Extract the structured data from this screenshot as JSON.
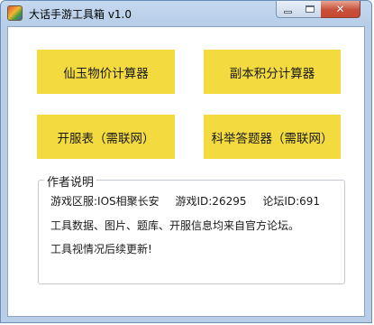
{
  "window": {
    "title": "大话手游工具箱 v1.0",
    "controls": {
      "minimize": "",
      "maximize": "",
      "close": "✕"
    }
  },
  "buttons": {
    "xianyu": "仙玉物价计算器",
    "fuben": "副本积分计算器",
    "kaifu": "开服表（需联网）",
    "keju": "科举答题器（需联网）"
  },
  "author": {
    "group_title": "作者说明",
    "server_label": "游戏区服:IOS相聚长安",
    "game_id": "游戏ID:26295",
    "forum_id": "论坛ID:691",
    "line2": "工具数据、图片、题库、开服信息均来自官方论坛。",
    "line3": "工具视情况后续更新!"
  },
  "colors": {
    "button_bg": "#f3da3f",
    "frame": "#b7cde8",
    "close": "#c7503a"
  }
}
